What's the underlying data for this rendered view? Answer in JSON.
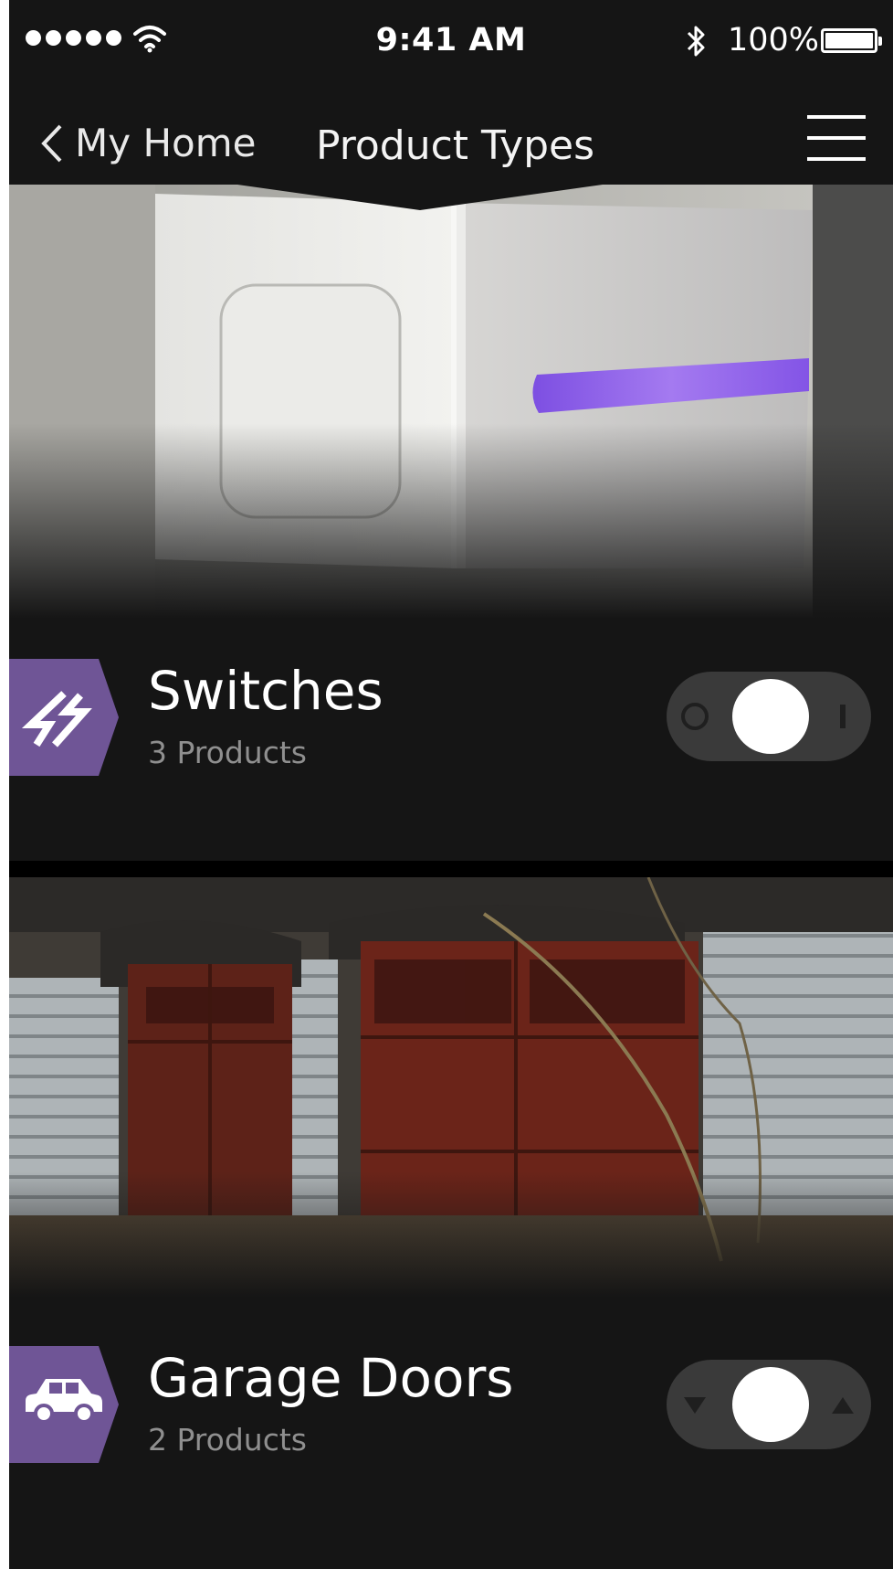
{
  "status_bar": {
    "time": "9:41 AM",
    "battery": "100%",
    "icons": [
      "signal-dots-icon",
      "wifi-icon",
      "bluetooth-icon",
      "battery-icon"
    ]
  },
  "nav": {
    "back_label": "My Home",
    "title": "Product Types",
    "icons": [
      "chevron-left-icon",
      "hamburger-menu-icon"
    ]
  },
  "items": [
    {
      "title": "Switches",
      "subtitle": "3 Products",
      "icon": "lightning-icon",
      "toggle": {
        "left_symbol": "off-circle-icon",
        "right_symbol": "on-bar-icon",
        "state": "center"
      }
    },
    {
      "title": "Garage Doors",
      "subtitle": "2 Products",
      "icon": "car-icon",
      "toggle": {
        "left_symbol": "down-arrow-icon",
        "right_symbol": "up-arrow-icon",
        "state": "center"
      }
    }
  ],
  "colors": {
    "background": "#151515",
    "accent_purple": "#6f5596",
    "toggle_track": "#3a3a3a",
    "subtitle_gray": "#8f8f8f"
  }
}
